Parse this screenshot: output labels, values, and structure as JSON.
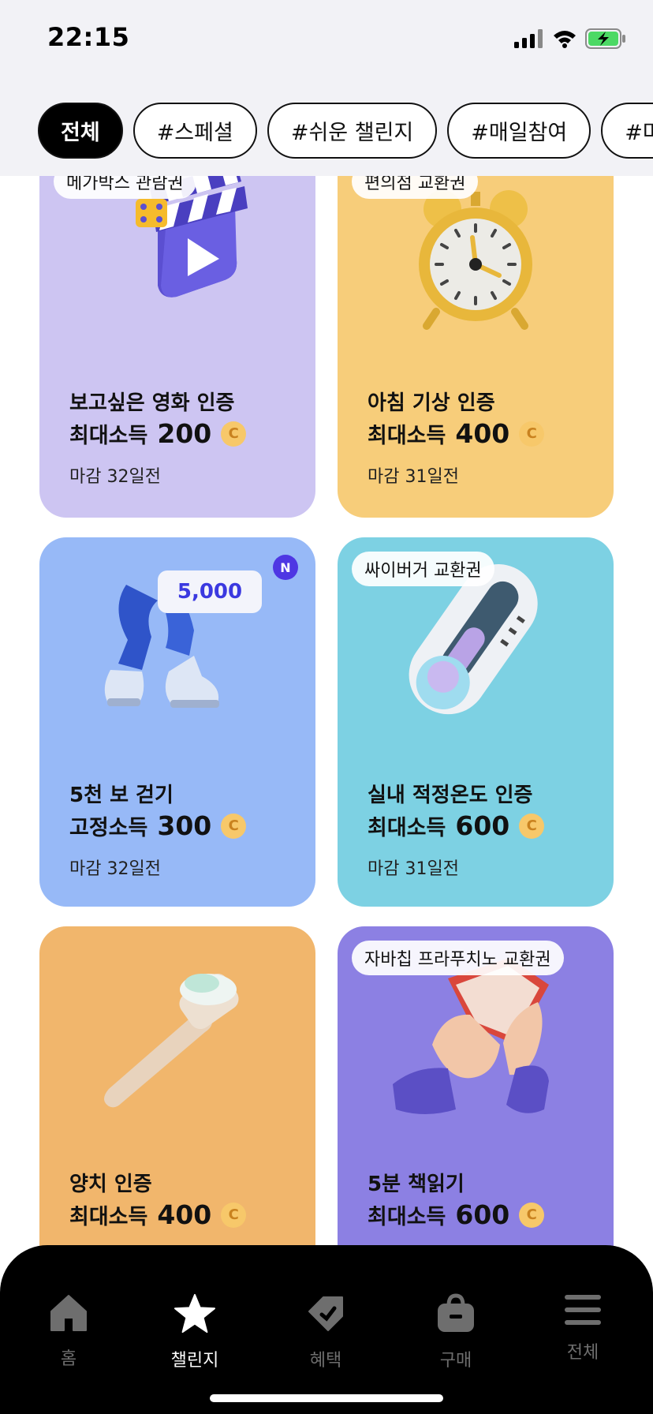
{
  "status_bar": {
    "time": "22:15"
  },
  "chips": [
    {
      "label": "전체",
      "active": true
    },
    {
      "label": "#스페셜"
    },
    {
      "label": "#쉬운 챌린지"
    },
    {
      "label": "#매일참여"
    },
    {
      "label": "#마음 실"
    }
  ],
  "cards": [
    {
      "tag": "메가박스 관람권",
      "title": "보고싶은 영화 인증",
      "reward_label": "최대소득",
      "reward_amount": "200",
      "coin": "C",
      "deadline": "마감 32일전",
      "color": "#cdc5f2"
    },
    {
      "tag": "편의점 교환권",
      "title": "아침 기상 인증",
      "reward_label": "최대소득",
      "reward_amount": "400",
      "coin": "C",
      "deadline": "마감 31일전",
      "color": "#f7cd7a"
    },
    {
      "badge": "N",
      "bubble": "5,000",
      "title": "5천 보 걷기",
      "reward_label": "고정소득",
      "reward_amount": "300",
      "coin": "C",
      "deadline": "마감 32일전",
      "color": "#97b9f7"
    },
    {
      "tag": "싸이버거 교환권",
      "title": "실내 적정온도 인증",
      "reward_label": "최대소득",
      "reward_amount": "600",
      "coin": "C",
      "deadline": "마감 31일전",
      "color": "#7dd1e3"
    },
    {
      "title": "양치 인증",
      "reward_label": "최대소득",
      "reward_amount": "400",
      "coin": "C",
      "color": "#f1b66c"
    },
    {
      "tag": "자바칩 프라푸치노 교환권",
      "title": "5분 책읽기",
      "reward_label": "최대소득",
      "reward_amount": "600",
      "coin": "C",
      "color": "#8c80e3"
    }
  ],
  "nav": [
    {
      "label": "홈",
      "icon": "home-icon"
    },
    {
      "label": "챌린지",
      "icon": "star-icon",
      "active": true
    },
    {
      "label": "혜택",
      "icon": "tag-icon"
    },
    {
      "label": "구매",
      "icon": "bag-icon"
    },
    {
      "label": "전체",
      "icon": "menu-icon"
    }
  ]
}
